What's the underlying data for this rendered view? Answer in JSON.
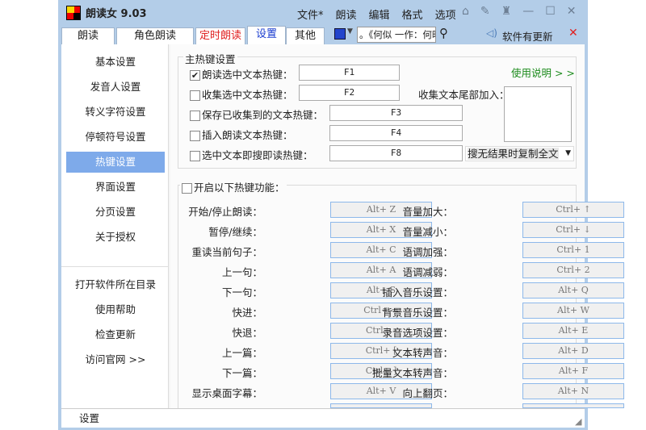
{
  "app": {
    "title": "朗读女 9.03"
  },
  "menu": [
    "文件*",
    "朗读",
    "编辑",
    "格式",
    "选项"
  ],
  "tabs": [
    {
      "label": "朗读"
    },
    {
      "label": "角色朗读"
    },
    {
      "label": "定时朗读"
    },
    {
      "label": "设置"
    },
    {
      "label": "其他"
    }
  ],
  "search": {
    "value": "。《何似 一作：何时；J"
  },
  "update": {
    "label": "软件有更新"
  },
  "sidebar": {
    "items": [
      "基本设置",
      "发音人设置",
      "转义字符设置",
      "停顿符号设置",
      "热键设置",
      "界面设置",
      "分页设置",
      "关于授权"
    ],
    "links": [
      "打开软件所在目录",
      "使用帮助",
      "检查更新",
      "访问官网 >>"
    ]
  },
  "main_hotkeys": {
    "title": "主热键设置",
    "help": "使用说明 > >",
    "tail_label": "收集文本尾部加入：",
    "dropdown": "搜无结果时复制全文",
    "rows": [
      {
        "label": "朗读选中文本热键：",
        "key": "F1",
        "checked": true
      },
      {
        "label": "收集选中文本热键：",
        "key": "F2",
        "checked": false
      },
      {
        "label": "保存已收集到的文本热键：",
        "key": "F3",
        "checked": false
      },
      {
        "label": "插入朗读文本热键：",
        "key": "F4",
        "checked": false
      },
      {
        "label": "选中文本即搜即读热键：",
        "key": "F8",
        "checked": false
      }
    ]
  },
  "func_hotkeys": {
    "title": "开启以下热键功能：",
    "left": [
      [
        "开始/停止朗读：",
        "Alt+ Z"
      ],
      [
        "暂停/继续：",
        "Alt+ X"
      ],
      [
        "重读当前句子：",
        "Alt+ C"
      ],
      [
        "上一句：",
        "Alt+ A"
      ],
      [
        "下一句：",
        "Alt+ S"
      ],
      [
        "快进：",
        "Ctrl+ ="
      ],
      [
        "快退：",
        "Ctrl+ -"
      ],
      [
        "上一篇：",
        "Ctrl+ ["
      ],
      [
        "下一篇：",
        "Ctrl+ ]"
      ],
      [
        "显示桌面字幕：",
        "Alt+ V"
      ]
    ],
    "right": [
      [
        "音量加大：",
        "Ctrl+ ↑"
      ],
      [
        "音量减小：",
        "Ctrl+ ↓"
      ],
      [
        "语调加强：",
        "Ctrl+ 1"
      ],
      [
        "语调减弱：",
        "Ctrl+ 2"
      ],
      [
        "插入音乐设置：",
        "Alt+ Q"
      ],
      [
        "背景音乐设置：",
        "Alt+ W"
      ],
      [
        "录音选项设置：",
        "Alt+ E"
      ],
      [
        "文本转声音：",
        "Alt+ D"
      ],
      [
        "批量文本转声音：",
        "Alt+ F"
      ],
      [
        "向上翻页：",
        "Alt+ N"
      ]
    ]
  },
  "status": {
    "text": "设置"
  },
  "colors": {
    "accent": "#7eaaea",
    "tab_red": "#e02020",
    "help_green": "#1a8a1a"
  }
}
